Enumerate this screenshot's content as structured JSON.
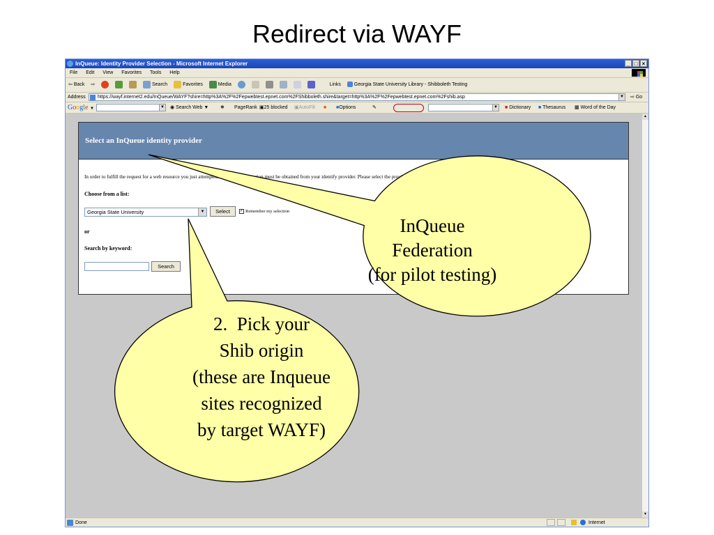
{
  "slide_title": "Redirect via WAYF",
  "window": {
    "title": "InQueue: Identity Provider Selection - Microsoft Internet Explorer",
    "buttons": [
      "_",
      "□",
      "×"
    ]
  },
  "menu": [
    "File",
    "Edit",
    "View",
    "Favorites",
    "Tools",
    "Help"
  ],
  "toolbar": {
    "back": "Back",
    "search": "Search",
    "favorites": "Favorites",
    "media": "Media",
    "links": "Links",
    "link_item": "Georgia State University Library - Shibboleth Testing"
  },
  "address": {
    "label": "Address",
    "url": "https://wayf.internet2.edu/InQueue/WAYF?shire=http%3A%2F%2Fepwebtest.epnet.com%2FShibboleth.shire&target=http%3A%2F%2Fepwebtest.epnet.com%2Fshib.asp",
    "go": "Go"
  },
  "googlebar": {
    "search_web": "Search Web",
    "pagerank": "PageRank",
    "blocked": "25 blocked",
    "autofill": "AutoFill",
    "options": "Options",
    "dictionary": "Dictionary",
    "thesaurus": "Thesaurus",
    "word_of_day": "Word of the Day"
  },
  "page": {
    "header": "Select an InQueue identity provider",
    "instructions": "In order to fulfill the request for a web resource you just attempted to access, information must be obtained from your identify provider. Please select the provider with which you are affiliated.",
    "choose_label": "Choose from a list:",
    "selected_provider": "Georgia State University",
    "select_button": "Select",
    "remember_label": "Remember my selection",
    "or_label": "or",
    "search_label": "Search by keyword:",
    "search_button": "Search"
  },
  "status": {
    "done": "Done",
    "zone": "Internet"
  },
  "callouts": {
    "inqueue": [
      "InQueue",
      "Federation",
      "(for pilot testing)"
    ],
    "pick": [
      "2.  Pick your",
      "Shib origin",
      "(these are Inqueue",
      "sites recognized",
      "by target WAYF)"
    ]
  },
  "colors": {
    "callout_fill": "#ffffa8",
    "header_bg": "#6686ad"
  }
}
